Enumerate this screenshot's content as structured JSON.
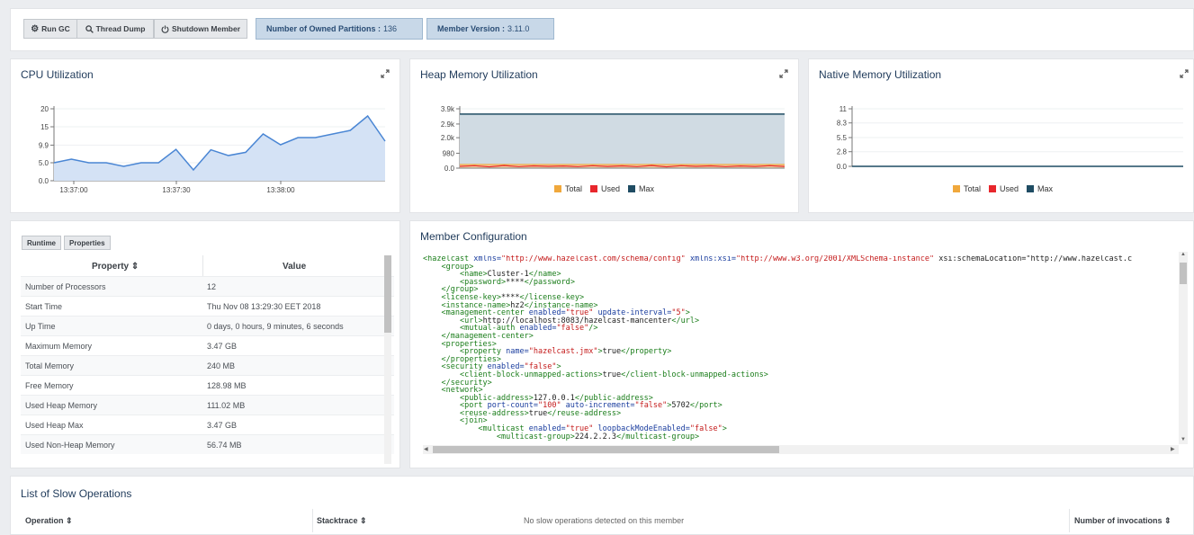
{
  "toolbar": {
    "run_gc": "Run GC",
    "thread_dump": "Thread Dump",
    "shutdown": "Shutdown Member",
    "partitions_label": "Number of Owned Partitions :",
    "partitions_value": "136",
    "version_label": "Member Version :",
    "version_value": "3.11.0"
  },
  "cpu": {
    "title": "CPU Utilization",
    "yticks": [
      "20",
      "15",
      "9.9",
      "5.0",
      "0.0"
    ],
    "xticks": [
      "13:37:00",
      "13:37:30",
      "13:38:00"
    ]
  },
  "heap": {
    "title": "Heap Memory Utilization",
    "yticks": [
      "3.9k",
      "2.9k",
      "2.0k",
      "980",
      "0.0"
    ]
  },
  "native": {
    "title": "Native Memory Utilization",
    "yticks": [
      "11",
      "8.3",
      "5.5",
      "2.8",
      "0.0"
    ]
  },
  "legend": {
    "total": "Total",
    "used": "Used",
    "max": "Max"
  },
  "colors": {
    "total": "#f0a83c",
    "used": "#e8262c",
    "max": "#1f4c63",
    "cpu_line": "#4a86d4",
    "cpu_fill": "#d4e2f5",
    "heap_fill": "#d0dbe3"
  },
  "chart_data": [
    {
      "type": "area",
      "title": "CPU Utilization",
      "x": [
        "13:36:49",
        "13:36:52",
        "13:36:55",
        "13:36:58",
        "13:37:03",
        "13:37:07",
        "13:37:13",
        "13:37:18",
        "13:37:23",
        "13:37:28",
        "13:37:33",
        "13:37:38",
        "13:37:43",
        "13:37:48",
        "13:37:53",
        "13:37:58",
        "13:38:03",
        "13:38:08",
        "13:38:13",
        "13:38:18",
        "13:38:23",
        "13:38:28",
        "13:38:31"
      ],
      "series": [
        {
          "values": [
            5,
            6,
            5,
            5,
            4,
            5,
            5,
            8.7,
            3,
            8.6,
            7,
            7.9,
            13,
            10,
            12,
            12,
            13,
            14,
            18,
            11
          ]
        }
      ],
      "ylim": [
        0,
        20
      ]
    },
    {
      "type": "area",
      "title": "Heap Memory Utilization",
      "series": [
        {
          "name": "Total",
          "values": [
            240,
            240,
            240,
            240,
            240,
            240,
            240,
            240,
            240,
            240,
            240,
            240,
            240,
            240,
            240,
            240,
            240,
            240,
            240,
            240,
            240,
            240,
            240
          ]
        },
        {
          "name": "Used",
          "values": [
            120,
            160,
            90,
            170,
            100,
            150,
            120,
            140,
            100,
            160,
            110,
            150,
            100,
            170,
            90,
            160,
            120,
            150,
            100,
            140,
            110,
            160,
            110
          ]
        },
        {
          "name": "Max",
          "values": [
            3550,
            3550,
            3550,
            3550,
            3550,
            3550,
            3550,
            3550,
            3550,
            3550,
            3550,
            3550,
            3550,
            3550,
            3550,
            3550,
            3550,
            3550,
            3550,
            3550,
            3550,
            3550,
            3550
          ]
        }
      ],
      "ylim": [
        0,
        3900
      ]
    },
    {
      "type": "line",
      "title": "Native Memory Utilization",
      "series": [
        {
          "name": "Total",
          "values": [
            0,
            0
          ]
        },
        {
          "name": "Used",
          "values": [
            0,
            0
          ]
        },
        {
          "name": "Max",
          "values": [
            0,
            0
          ]
        }
      ],
      "ylim": [
        0,
        11
      ]
    }
  ],
  "runtime": {
    "tab_runtime": "Runtime",
    "tab_properties": "Properties",
    "col_property": "Property ⇕",
    "col_value": "Value",
    "rows": [
      {
        "p": "Number of Processors",
        "v": "12"
      },
      {
        "p": "Start Time",
        "v": "Thu Nov 08 13:29:30 EET 2018"
      },
      {
        "p": "Up Time",
        "v": "0 days, 0 hours, 9 minutes, 6 seconds"
      },
      {
        "p": "Maximum Memory",
        "v": "3.47 GB"
      },
      {
        "p": "Total Memory",
        "v": "240 MB"
      },
      {
        "p": "Free Memory",
        "v": "128.98 MB"
      },
      {
        "p": "Used Heap Memory",
        "v": "111.02 MB"
      },
      {
        "p": "Used Heap Max",
        "v": "3.47 GB"
      },
      {
        "p": "Used Non-Heap Memory",
        "v": "56.74 MB"
      }
    ]
  },
  "config": {
    "title": "Member Configuration",
    "lines": [
      "<hazelcast xmlns=\"http://www.hazelcast.com/schema/config\" xmlns:xsi=\"http://www.w3.org/2001/XMLSchema-instance\" xsi:schemaLocation=\"http://www.hazelcast.c",
      "    <group>",
      "        <name>Cluster-1</name>",
      "        <password>****</password>",
      "    </group>",
      "    <license-key>****</license-key>",
      "    <instance-name>hz2</instance-name>",
      "    <management-center enabled=\"true\" update-interval=\"5\">",
      "        <url>http://localhost:8083/hazelcast-mancenter</url>",
      "        <mutual-auth enabled=\"false\"/>",
      "    </management-center>",
      "    <properties>",
      "        <property name=\"hazelcast.jmx\">true</property>",
      "    </properties>",
      "    <security enabled=\"false\">",
      "        <client-block-unmapped-actions>true</client-block-unmapped-actions>",
      "    </security>",
      "    <network>",
      "        <public-address>127.0.0.1</public-address>",
      "        <port port-count=\"100\" auto-increment=\"false\">5702</port>",
      "        <reuse-address>true</reuse-address>",
      "        <join>",
      "            <multicast enabled=\"true\" loopbackModeEnabled=\"false\">",
      "                <multicast-group>224.2.2.3</multicast-group>"
    ]
  },
  "slow": {
    "title": "List of Slow Operations",
    "col_operation": "Operation ⇕",
    "col_stacktrace": "Stacktrace ⇕",
    "empty": "No slow operations detected on this member",
    "col_invocations": "Number of invocations ⇕"
  }
}
